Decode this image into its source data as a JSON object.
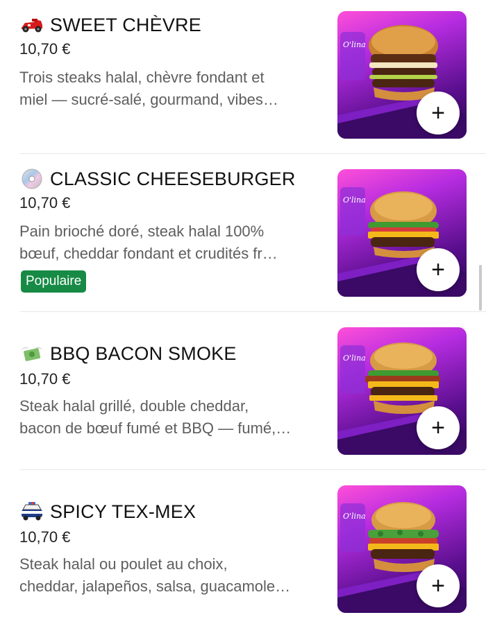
{
  "items": [
    {
      "icon": "race-car-icon",
      "title": "SWEET CHÈVRE",
      "price": "10,70 €",
      "desc_line1": "Trois steaks halal, chèvre fondant et",
      "desc_line2": "miel — sucré-salé, gourmand, vibes…",
      "badge": "",
      "logo": "O'lina"
    },
    {
      "icon": "cd-disc-icon",
      "title": "CLASSIC CHEESEBURGER",
      "price": "10,70 €",
      "desc_line1": "Pain brioché doré, steak halal 100%",
      "desc_line2": "bœuf, cheddar fondant et crudités fr…",
      "badge": "Populaire",
      "logo": "O'lina"
    },
    {
      "icon": "money-with-wings-icon",
      "title": "BBQ BACON SMOKE",
      "price": "10,70 €",
      "desc_line1": "Steak halal grillé, double cheddar,",
      "desc_line2": "bacon de bœuf fumé et BBQ — fumé,…",
      "badge": "",
      "logo": "O'lina"
    },
    {
      "icon": "police-car-icon",
      "title": "SPICY TEX-MEX",
      "price": "10,70 €",
      "desc_line1": "Steak halal ou poulet au choix,",
      "desc_line2": "cheddar, jalapeños, salsa, guacamole…",
      "badge": "",
      "logo": "O'lina"
    }
  ],
  "add_label": "+",
  "colors": {
    "badge": "#178a45",
    "thumb_accent": "#c62fe0"
  }
}
